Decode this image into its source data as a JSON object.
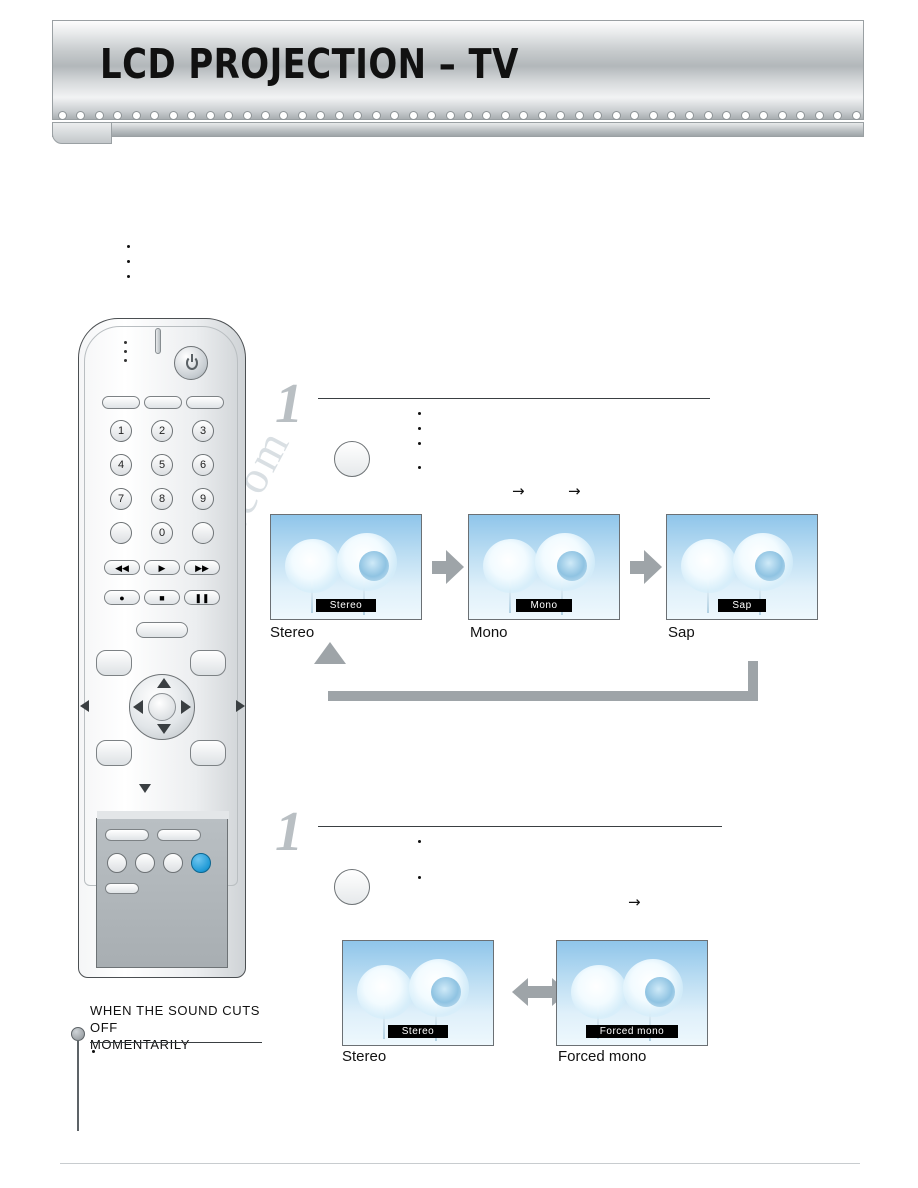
{
  "header": {
    "title": "LCD PROJECTION – TV",
    "dot_count": 44
  },
  "watermark": {
    "text": "manualsdrive.com"
  },
  "steps": [
    {
      "number": "1"
    },
    {
      "number": "1"
    }
  ],
  "flow_stereo": {
    "screens": [
      {
        "osd": "Stereo",
        "caption": "Stereo"
      },
      {
        "osd": "Mono",
        "caption": "Mono"
      },
      {
        "osd": "Sap",
        "caption": "Sap"
      }
    ],
    "arrow_glyph": "→"
  },
  "flow_mono": {
    "screens": [
      {
        "osd": "Stereo",
        "caption": "Stereo"
      },
      {
        "osd": "Forced mono",
        "caption": "Forced mono"
      }
    ],
    "arrow_glyph": "→"
  },
  "note": {
    "title_line1": "WHEN THE SOUND CUTS OFF",
    "title_line2": "MOMENTARILY"
  },
  "remote": {
    "number_keys": [
      "1",
      "2",
      "3",
      "4",
      "5",
      "6",
      "7",
      "8",
      "9",
      "0"
    ],
    "transport_glyphs": [
      "◀◀",
      "▶",
      "▶▶"
    ],
    "transport2_glyphs": [
      "●",
      "■",
      "❚❚"
    ]
  },
  "colors": {
    "accent_blue": "#1f9ad6",
    "arrow_gray": "#9ea4a8",
    "osd_bg": "#000000",
    "osd_text": "#ffffff",
    "header_dark": "#111111"
  }
}
